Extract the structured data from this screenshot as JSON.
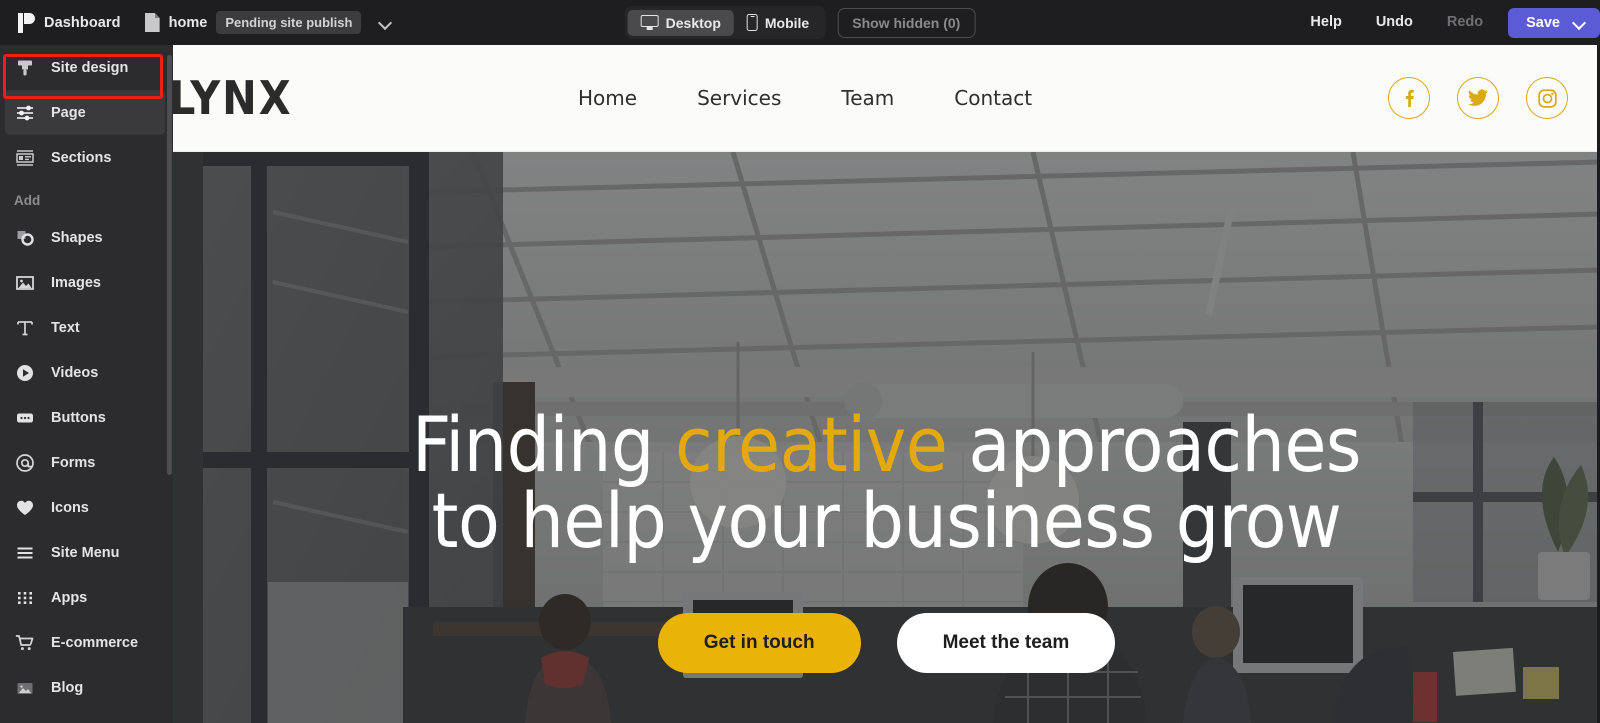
{
  "topbar": {
    "dashboard_label": "Dashboard",
    "dashboard_icon": "dashboard-logo-icon",
    "page_icon": "document-icon",
    "page_name": "home",
    "publish_status": "Pending site publish",
    "dropdown_icon": "chevron-down-icon",
    "devices": [
      {
        "label": "Desktop",
        "icon": "desktop-icon",
        "active": true
      },
      {
        "label": "Mobile",
        "icon": "mobile-icon",
        "active": false
      }
    ],
    "show_hidden_label": "Show hidden (0)",
    "help_label": "Help",
    "undo_label": "Undo",
    "redo_label": "Redo",
    "save_label": "Save",
    "save_chevron_icon": "chevron-down-icon",
    "save_color": "#5B5BD6",
    "background": "#1E1E20"
  },
  "sidebar": {
    "background": "#2C2C2E",
    "selected_item": "Page",
    "highlight_color": "#EF1D1D",
    "items": [
      {
        "label": "Site design",
        "icon": "paint-brush-icon"
      },
      {
        "label": "Page",
        "icon": "sliders-icon"
      },
      {
        "label": "Sections",
        "icon": "sections-layout-icon"
      }
    ],
    "add_heading": "Add",
    "add_items": [
      {
        "label": "Shapes",
        "icon": "shapes-icon"
      },
      {
        "label": "Images",
        "icon": "image-icon"
      },
      {
        "label": "Text",
        "icon": "text-t-icon"
      },
      {
        "label": "Videos",
        "icon": "play-circle-icon"
      },
      {
        "label": "Buttons",
        "icon": "button-icon"
      },
      {
        "label": "Forms",
        "icon": "at-sign-icon"
      },
      {
        "label": "Icons",
        "icon": "heart-icon"
      },
      {
        "label": "Site Menu",
        "icon": "hamburger-menu-icon"
      },
      {
        "label": "Apps",
        "icon": "grid-dots-icon"
      },
      {
        "label": "E-commerce",
        "icon": "shopping-cart-icon"
      },
      {
        "label": "Blog",
        "icon": "image-icon"
      }
    ]
  },
  "site": {
    "logo": "LYNX",
    "nav": [
      {
        "label": "Home"
      },
      {
        "label": "Services"
      },
      {
        "label": "Team"
      },
      {
        "label": "Contact"
      }
    ],
    "socials": [
      {
        "name": "facebook-icon"
      },
      {
        "name": "twitter-icon"
      },
      {
        "name": "instagram-icon"
      }
    ],
    "social_color": "#DBA818",
    "hero": {
      "heading_line1_pre": "Finding ",
      "heading_line1_accent": "creative",
      "heading_line1_post": " approaches",
      "heading_line2": "to help your business grow",
      "accent_color": "#E3A90F",
      "buttons": [
        {
          "label": "Get in touch",
          "style": "primary",
          "color": "#EAB308"
        },
        {
          "label": "Meet the team",
          "style": "secondary",
          "color": "#FFFFFF"
        }
      ]
    }
  }
}
